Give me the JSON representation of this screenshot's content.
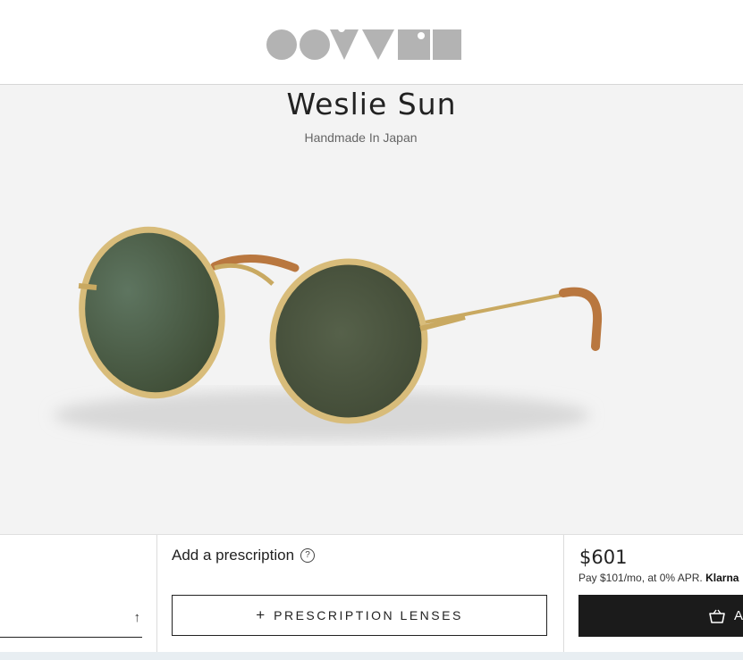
{
  "header": {
    "logo_alt": "OLIVER PEOPLES"
  },
  "product": {
    "name": "Weslie Sun",
    "tagline": "Handmade In Japan"
  },
  "prescription": {
    "label": "Add a prescription",
    "help_icon": "?",
    "button_label": "PRESCRIPTION LENSES",
    "button_icon": "+"
  },
  "left_field": {
    "icon": "↑"
  },
  "purchase": {
    "price": "$601",
    "financing_text": "Pay $101/mo, at 0% APR.",
    "financing_brand": "Klarna",
    "add_button_label": "A"
  },
  "colors": {
    "accent": "#1b1b1b",
    "logo_gray": "#b3b3b3",
    "frame_gold": "#c9a961",
    "lens_green": "#4a5a3f",
    "temple_tortoise": "#b9773f"
  }
}
